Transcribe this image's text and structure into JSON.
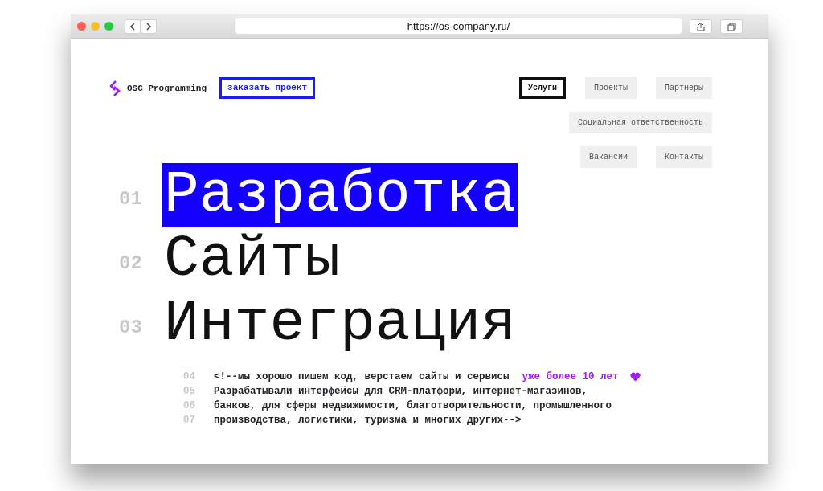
{
  "browser": {
    "url": "https://os-company.ru/"
  },
  "logo": {
    "text": "OSC Programming"
  },
  "order_button": {
    "label": "заказать проект"
  },
  "nav_rows": [
    [
      {
        "label": "Услуги",
        "selected": true
      },
      {
        "label": "Проекты",
        "selected": false
      },
      {
        "label": "Партнеры",
        "selected": false
      }
    ],
    [
      {
        "label": "Социальная ответственность",
        "selected": false
      }
    ],
    [
      {
        "label": "Вакансии",
        "selected": false
      },
      {
        "label": "Контакты",
        "selected": false
      }
    ]
  ],
  "headlines": [
    {
      "number": "01",
      "text": "Разработка",
      "selected": true
    },
    {
      "number": "02",
      "text": "Сайты",
      "selected": false
    },
    {
      "number": "03",
      "text": "Интеграция",
      "selected": false
    }
  ],
  "code_lines": [
    {
      "number": "04",
      "text": "<!--мы хорошо пишем код, верстаем сайты и сервисы",
      "accent": "уже более 10 лет"
    },
    {
      "number": "05",
      "text": "Разрабатывали интерфейсы для CRM-платформ, интернет-магазинов,"
    },
    {
      "number": "06",
      "text": "банков, для сферы недвижимости, благотворительности, промышленного"
    },
    {
      "number": "07",
      "text": "производства, логистики, туризма и многих других-->"
    }
  ]
}
